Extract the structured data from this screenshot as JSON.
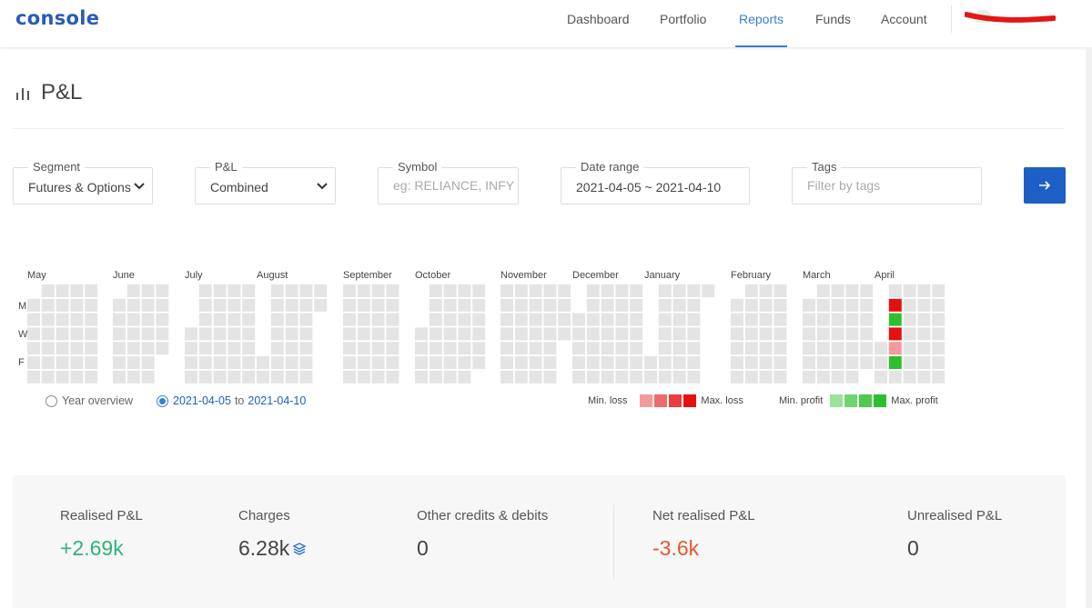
{
  "app": {
    "logo": "console",
    "nav": [
      {
        "label": "Dashboard",
        "active": false
      },
      {
        "label": "Portfolio",
        "active": false
      },
      {
        "label": "Reports",
        "active": true
      },
      {
        "label": "Funds",
        "active": false
      },
      {
        "label": "Account",
        "active": false
      }
    ],
    "accent_color": "#387ed1"
  },
  "page": {
    "title": "P&L"
  },
  "filters": {
    "segment": {
      "label": "Segment",
      "value": "Futures & Options"
    },
    "pnl": {
      "label": "P&L",
      "value": "Combined"
    },
    "symbol": {
      "label": "Symbol",
      "placeholder": "eg: RELIANCE, INFY",
      "value": ""
    },
    "date_range": {
      "label": "Date range",
      "value": "2021-04-05 ~ 2021-04-10"
    },
    "tags": {
      "label": "Tags",
      "placeholder": "Filter by tags",
      "value": ""
    },
    "submit_icon": "arrow-right-icon"
  },
  "heatmap": {
    "months": [
      "May",
      "June",
      "July",
      "August",
      "September",
      "October",
      "November",
      "December",
      "January",
      "February",
      "March",
      "April"
    ],
    "day_labels": [
      "M",
      "W",
      "F"
    ],
    "highlighted_week": "April",
    "highlighted_days": [
      {
        "day": "Mon",
        "status": "max-loss"
      },
      {
        "day": "Tue",
        "status": "max-profit"
      },
      {
        "day": "Wed",
        "status": "max-loss"
      },
      {
        "day": "Thu",
        "status": "min-loss"
      },
      {
        "day": "Fri",
        "status": "max-profit"
      }
    ],
    "colors": {
      "empty": "#e4e4e4",
      "loss": [
        "#f49a9a",
        "#ef6b6b",
        "#ea3e3e",
        "#e51010"
      ],
      "profit": [
        "#9be29b",
        "#6fd66f",
        "#4ccb4c",
        "#2ebf2e"
      ]
    }
  },
  "view_options": {
    "year_overview": "Year overview",
    "range_from": "2021-04-05",
    "range_to_word": "to",
    "range_to": "2021-04-10",
    "selected": "range"
  },
  "legend": {
    "min_loss": "Min. loss",
    "max_loss": "Max. loss",
    "min_profit": "Min. profit",
    "max_profit": "Max. profit"
  },
  "summary": {
    "realised": {
      "label": "Realised P&L",
      "value": "+2.69k"
    },
    "charges": {
      "label": "Charges",
      "value": "6.28k"
    },
    "other": {
      "label": "Other credits & debits",
      "value": "0"
    },
    "net": {
      "label": "Net realised P&L",
      "value": "-3.6k"
    },
    "unrealised": {
      "label": "Unrealised P&L",
      "value": "0"
    }
  }
}
